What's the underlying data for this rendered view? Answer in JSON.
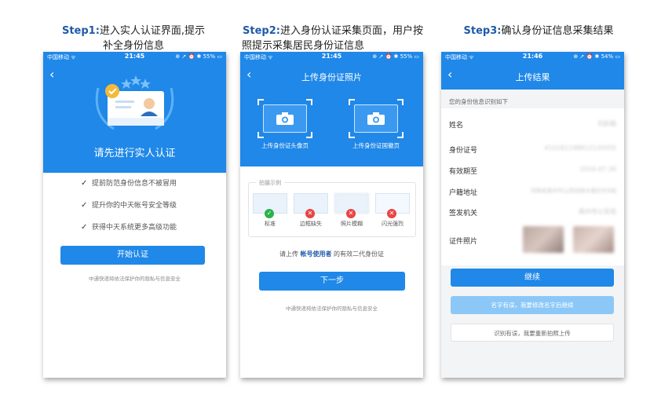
{
  "steps": [
    {
      "label": "Step1:",
      "text_line1": "进入实人认证界面,提示",
      "text_line2": "补全身份信息"
    },
    {
      "label": "Step2:",
      "text_line1": "进入身份认证采集页面，用户按",
      "text_line2": "照提示采集居民身份证信息"
    },
    {
      "label": "Step3:",
      "text_line1": "确认身份证信息采集结果",
      "text_line2": ""
    }
  ],
  "phone1": {
    "status": {
      "carrier": "中国移动 ᯤ",
      "time": "21:45",
      "battery": "⊕ ➚ ⏰ ✱ 55% ▭"
    },
    "back": "‹",
    "hero_title": "请先进行实人认证",
    "checks": [
      "提前防范身份信息不被冒用",
      "提升你的中天帐号安全等级",
      "获得中天系统更多高级功能"
    ],
    "button": "开始认证",
    "footer": "中通快递将依法保护你的隐私与信息安全"
  },
  "phone2": {
    "status": {
      "carrier": "中国移动 ᯤ",
      "time": "21:45",
      "battery": "⊕ ➚ ⏰ ✱ 55% ▭"
    },
    "back": "‹",
    "title": "上传身份证照片",
    "front_caption": "上传身份证头像页",
    "back_caption": "上传身份证国徽页",
    "sample_title": "拍摄示例",
    "samples": [
      {
        "label": "标准",
        "ok": true
      },
      {
        "label": "边框缺失",
        "ok": false
      },
      {
        "label": "照片模糊",
        "ok": false
      },
      {
        "label": "闪光强烈",
        "ok": false
      }
    ],
    "hint_prefix": "请上传",
    "hint_account": "帐号使用者",
    "hint_suffix": "的有效二代身份证",
    "button": "下一步",
    "footer": "中通快递将依法保护你的隐私与信息安全"
  },
  "phone3": {
    "status": {
      "carrier": "中国移动 ᯤ",
      "time": "21:46",
      "battery": "⊕ ➚ ⏰ ✱ 54% ▭"
    },
    "back": "‹",
    "title": "上传结果",
    "subtitle": "您的身份信息识别如下",
    "fields": [
      {
        "key": "姓名",
        "value": "刘彩娟"
      },
      {
        "key": "身份证号",
        "value": "410281198812120055"
      },
      {
        "key": "有效期至",
        "value": "2016-07-30"
      },
      {
        "key": "户籍地址",
        "value": "河南省禹州市山货回族乡题庄村9组"
      },
      {
        "key": "签发机关",
        "value": "禹州市公安局"
      }
    ],
    "photo_label": "证件照片",
    "continue_button": "继续",
    "edit_name_button": "名字有误，我要修改名字后继续",
    "reupload_button": "识别有误，我要重新拍照上传"
  },
  "colors": {
    "primary": "#1f88e8",
    "title_blue": "#1f5aa8",
    "ok": "#2bb24c",
    "bad": "#e94545"
  }
}
